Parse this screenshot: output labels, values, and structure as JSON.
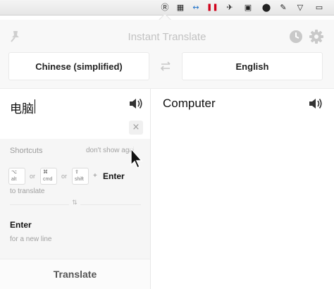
{
  "menubar": {
    "icons": [
      {
        "name": "instant-translate-icon",
        "glyph": "Ⓡ"
      },
      {
        "name": "calendar-icon",
        "glyph": "▦"
      },
      {
        "name": "teamviewer-icon",
        "glyph": "↔"
      },
      {
        "name": "pause-icon",
        "glyph": "❚❚"
      },
      {
        "name": "bird-icon",
        "glyph": "✈"
      },
      {
        "name": "monitor-icon",
        "glyph": "▣"
      },
      {
        "name": "wechat-icon",
        "glyph": "⬤"
      },
      {
        "name": "edit-icon",
        "glyph": "✎"
      },
      {
        "name": "wifi-icon",
        "glyph": "▽"
      },
      {
        "name": "airplay-icon",
        "glyph": "▭"
      }
    ]
  },
  "header": {
    "title": "Instant Translate",
    "source_language": "Chinese (simplified)",
    "target_language": "English"
  },
  "source": {
    "text": "电脑"
  },
  "result": {
    "text": "Computer"
  },
  "clear_glyph": "×",
  "shortcuts": {
    "title": "Shortcuts",
    "dismiss": "don't show again",
    "keys": [
      {
        "symbol": "⌥",
        "name": "alt"
      },
      {
        "symbol": "⌘",
        "name": "cmd"
      },
      {
        "symbol": "⇧",
        "name": "shift"
      }
    ],
    "or": "or",
    "plus": "+",
    "enter": "Enter",
    "to_translate": "to translate",
    "separator_glyph": "⇅",
    "enter2": "Enter",
    "new_line": "for a new line"
  },
  "translate_button": "Translate",
  "colors": {
    "header_bg": "#f8f8f8",
    "shortcuts_bg": "#f6f6f6",
    "pause_icon": "#d0021b"
  }
}
